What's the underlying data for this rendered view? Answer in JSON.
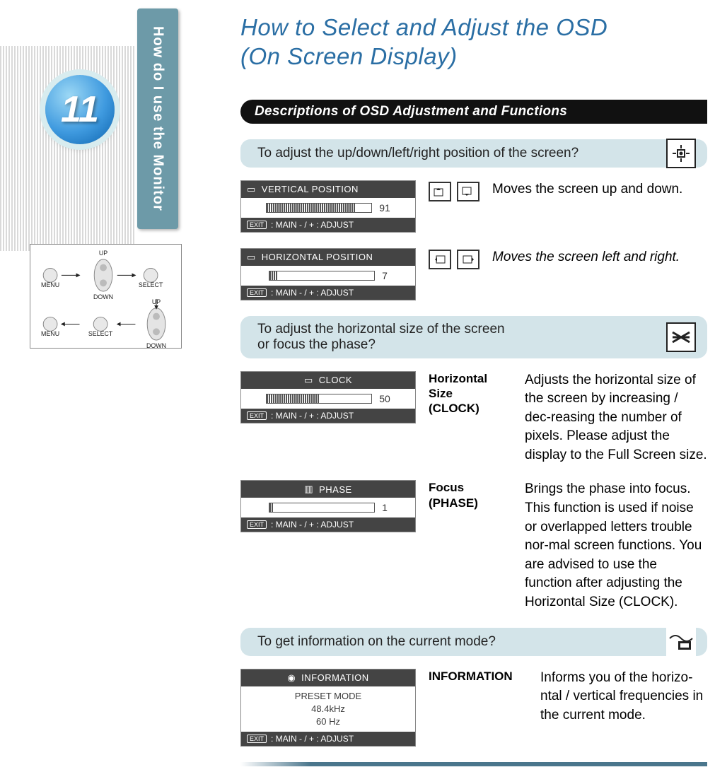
{
  "sidebar": {
    "page_number": "11",
    "tab_label": "How do I use the Monitor",
    "buttons": {
      "menu": "MENU",
      "select": "SELECT",
      "up": "UP",
      "down": "DOWN"
    }
  },
  "page": {
    "title_line1": "How to Select and Adjust the OSD",
    "title_line2": "(On Screen Display)",
    "section_header": "Descriptions of OSD Adjustment and Functions"
  },
  "sub1": {
    "heading": "To adjust the up/down/left/right position of the screen?",
    "vert": {
      "osd_title": "VERTICAL POSITION",
      "value": "91",
      "foot": ": MAIN        - / + : ADJUST",
      "desc": "Moves the screen up and down."
    },
    "horiz": {
      "osd_title": "HORIZONTAL POSITION",
      "value": "7",
      "foot": ": MAIN        - / + : ADJUST",
      "desc": "Moves the screen left and right."
    }
  },
  "sub2": {
    "heading_l1": "To adjust the horizontal size of the screen",
    "heading_l2": "or focus the phase?",
    "clock": {
      "osd_title": "CLOCK",
      "value": "50",
      "foot": ": MAIN        - / + : ADJUST",
      "label_l1": "Horizontal",
      "label_l2": "Size",
      "label_l3": "(CLOCK)",
      "desc": "Adjusts the horizontal size of the screen by increasing / dec-reasing the number of pixels. Please adjust the display to the Full Screen size."
    },
    "phase": {
      "osd_title": "PHASE",
      "value": "1",
      "foot": ": MAIN        - / + : ADJUST",
      "label_l1": "Focus",
      "label_l2": "(PHASE)",
      "desc": "Brings the phase into focus. This function   is used  if noise or overlapped  letters trouble  nor-mal screen functions. You are advised to  use the  function after adjusting the Horizontal Size (CLOCK)."
    }
  },
  "sub3": {
    "heading": "To get information on the current mode?",
    "info": {
      "osd_title": "INFORMATION",
      "line1": "PRESET MODE",
      "line2": "48.4kHz",
      "line3": "60    Hz",
      "foot": ": MAIN        - / + : ADJUST",
      "label": "INFORMATION",
      "desc": "Informs you of the horizo-ntal / vertical frequencies in the current mode."
    }
  },
  "exit_label": "EXIT"
}
